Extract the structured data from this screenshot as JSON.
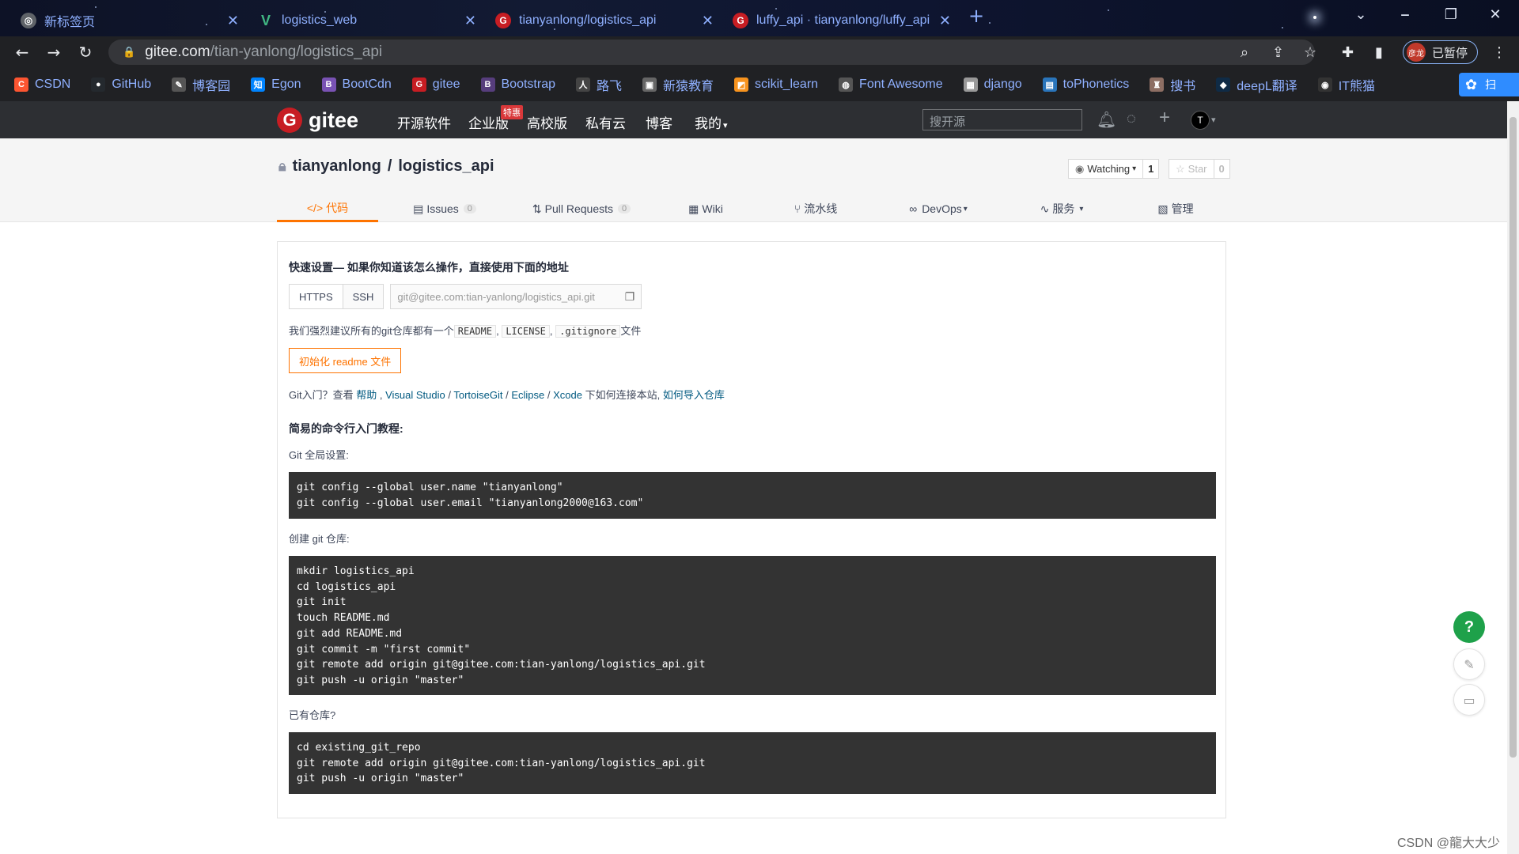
{
  "browser": {
    "tabs": [
      {
        "title": "新标签页",
        "icon": "globe-icon",
        "icon_color": "#5f6368"
      },
      {
        "title": "logistics_web",
        "icon": "vue-icon",
        "icon_color": "#41b883"
      },
      {
        "title": "tianyanlong/logistics_api",
        "icon": "gitee-icon",
        "icon_color": "#c71d23"
      },
      {
        "title": "luffy_api · tianyanlong/luffy_api",
        "icon": "gitee-icon",
        "icon_color": "#c71d23"
      }
    ],
    "new_tab_icon": "plus-icon",
    "address": {
      "domain": "gitee.com",
      "path": "/tian-yanlong/logistics_api"
    },
    "profile": {
      "avatar_text": "彦龙",
      "label": "已暂停"
    },
    "bookmarks": [
      {
        "label": "CSDN",
        "color": "#fc5531",
        "glyph": "C"
      },
      {
        "label": "GitHub",
        "color": "#24292e",
        "glyph": "●"
      },
      {
        "label": "博客园",
        "color": "#555555",
        "glyph": "✎"
      },
      {
        "label": "Egon",
        "color": "#0084ff",
        "glyph": "知"
      },
      {
        "label": "BootCdn",
        "color": "#7952b3",
        "glyph": "B"
      },
      {
        "label": "gitee",
        "color": "#c71d23",
        "glyph": "G"
      },
      {
        "label": "Bootstrap",
        "color": "#563d7c",
        "glyph": "B"
      },
      {
        "label": "路飞",
        "color": "#444444",
        "glyph": "人"
      },
      {
        "label": "新猿教育",
        "color": "#666666",
        "glyph": "▣"
      },
      {
        "label": "scikit_learn",
        "color": "#f7931e",
        "glyph": "◩"
      },
      {
        "label": "Font Awesome",
        "color": "#555555",
        "glyph": "◍"
      },
      {
        "label": "django",
        "color": "#999999",
        "glyph": "▦"
      },
      {
        "label": "toPhonetics",
        "color": "#2a75bb",
        "glyph": "▤"
      },
      {
        "label": "搜书",
        "color": "#8d6e63",
        "glyph": "♜"
      },
      {
        "label": "deepL翻译",
        "color": "#0f2b46",
        "glyph": "◆"
      },
      {
        "label": "IT熊猫",
        "color": "#333333",
        "glyph": "◉"
      }
    ],
    "bookmark_extra": "扫"
  },
  "gitee": {
    "logo_text": "gitee",
    "nav": [
      "开源软件",
      "企业版",
      "高校版",
      "私有云",
      "博客",
      "我的"
    ],
    "nav_badge": "特惠",
    "search_placeholder": "搜开源",
    "avatar_text": "T"
  },
  "repo": {
    "owner": "tianyanlong",
    "separator": "/",
    "name": "logistics_api",
    "watch": {
      "label": "Watching",
      "count": "1"
    },
    "star": {
      "label": "Star",
      "count": "0"
    },
    "tabs": [
      {
        "label": "代码",
        "icon": "code-icon",
        "count": ""
      },
      {
        "label": "Issues",
        "icon": "issues-icon",
        "count": "0"
      },
      {
        "label": "Pull Requests",
        "icon": "pull-request-icon",
        "count": "0"
      },
      {
        "label": "Wiki",
        "icon": "wiki-icon",
        "count": ""
      },
      {
        "label": "流水线",
        "icon": "pipeline-icon",
        "count": ""
      },
      {
        "label": "DevOps",
        "icon": "devops-icon",
        "count": ""
      },
      {
        "label": "服务",
        "icon": "service-icon",
        "count": ""
      },
      {
        "label": "管理",
        "icon": "manage-icon",
        "count": ""
      }
    ]
  },
  "setup": {
    "quick_title": "快速设置— 如果你知道该怎么操作，直接使用下面的地址",
    "protocols": [
      "HTTPS",
      "SSH"
    ],
    "clone_url": "git@gitee.com:tian-yanlong/logistics_api.git",
    "recommend_prefix": "我们强烈建议所有的git仓库都有一个",
    "recommend_files": [
      "README",
      "LICENSE",
      ".gitignore"
    ],
    "recommend_suffix": "文件",
    "init_button": "初始化 readme 文件",
    "git_intro": {
      "prefix": "Git入门？查看 ",
      "help": "帮助",
      "sep1": " , ",
      "vs": "Visual Studio",
      "slash1": " / ",
      "tortoise": "TortoiseGit",
      "slash2": " / ",
      "eclipse": "Eclipse",
      "slash3": " / ",
      "xcode": "Xcode",
      "middle": " 下如何连接本站, ",
      "import": "如何导入仓库"
    },
    "tutorial_title": "简易的命令行入门教程:",
    "global_label": "Git 全局设置:",
    "global_cmds": [
      "git config --global user.name \"tianyanlong\"",
      "git config --global user.email \"tianyanlong2000@163.com\""
    ],
    "create_label": "创建 git 仓库:",
    "create_cmds": [
      "mkdir logistics_api",
      "cd logistics_api",
      "git init",
      "touch README.md",
      "git add README.md",
      "git commit -m \"first commit\"",
      "git remote add origin git@gitee.com:tian-yanlong/logistics_api.git",
      "git push -u origin \"master\""
    ],
    "existing_label": "已有仓库?",
    "existing_cmds": [
      "cd existing_git_repo",
      "git remote add origin git@gitee.com:tian-yanlong/logistics_api.git",
      "git push -u origin \"master\""
    ]
  },
  "floating": {
    "help": "?"
  },
  "watermark": "CSDN @龍大大少"
}
